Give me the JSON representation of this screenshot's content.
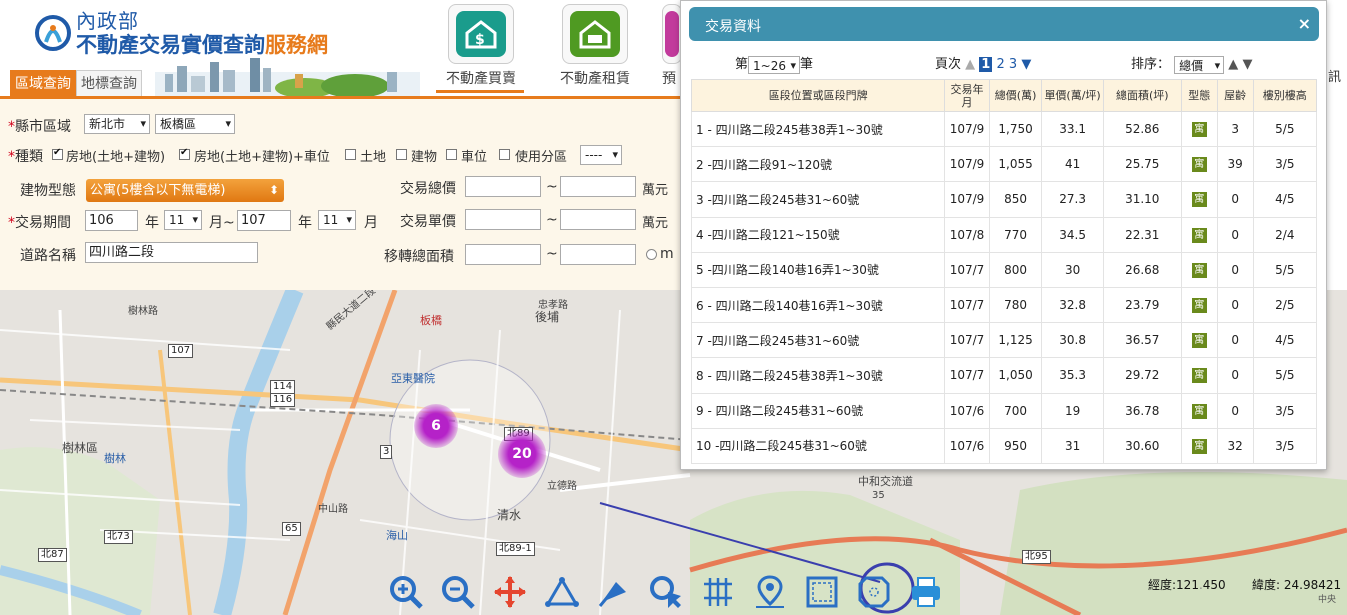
{
  "header": {
    "logo_line1": "內政部",
    "logo_line2_blue": "不動產交易實價查詢",
    "logo_line2_orange": "服務網",
    "tabs": [
      {
        "label": "區域查詢"
      },
      {
        "label": "地標查詢"
      }
    ],
    "nav": [
      {
        "label": "不動產買賣",
        "color": "#1a9c8c"
      },
      {
        "label": "不動產租賃",
        "color": "#4f9a22"
      },
      {
        "label": "預",
        "color": "#c23a9c"
      }
    ],
    "right_cut": "訊"
  },
  "form": {
    "district_label": "縣市區域",
    "city": "新北市",
    "district": "板橋區",
    "type_label": "種類",
    "types": [
      {
        "label": "房地(土地+建物)",
        "checked": true
      },
      {
        "label": "房地(土地+建物)+車位",
        "checked": true
      },
      {
        "label": "土地",
        "checked": false
      },
      {
        "label": "建物",
        "checked": false
      },
      {
        "label": "車位",
        "checked": false
      },
      {
        "label": "使用分區",
        "checked": false
      }
    ],
    "zone_select": "----",
    "building_label": "建物型態",
    "building_value": "公寓(5樓含以下無電梯)",
    "total_price_label": "交易總價",
    "unit_price_label": "交易單價",
    "area_label": "移轉總面積",
    "unit_wan": "萬元",
    "tilde": "~",
    "unit_m2": "m",
    "period_label": "交易期間",
    "year_from": "106",
    "month_from": "11",
    "year_to": "107",
    "month_to": "11",
    "year_txt": "年",
    "month_to_txt": "月~",
    "month_txt": "月",
    "road_label": "道路名稱",
    "road_value": "四川路二段"
  },
  "map": {
    "labels": [
      "樹林區",
      "樹林",
      "亞東醫院",
      "板橋",
      "後埔",
      "清水",
      "海山",
      "中和交流道",
      "忠孝路",
      "立德路",
      "縣民大道二段",
      "樹林路",
      "中山路",
      "北89",
      "北89-1",
      "北87",
      "北73",
      "北95",
      "107",
      "114",
      "116",
      "3",
      "65",
      "35"
    ],
    "clusters": [
      {
        "count": "6",
        "color": "#b522c8"
      },
      {
        "count": "20",
        "color": "#b522c8"
      }
    ],
    "tools": [
      "zoom-in-icon",
      "zoom-out-icon",
      "pan-icon",
      "measure-distance-icon",
      "measure-area-icon",
      "select-icon",
      "grid-icon",
      "locate-icon",
      "rectangle-select-icon",
      "polygon-select-icon",
      "print-icon"
    ],
    "lon_label": "經度:121",
    "lon_rest": "450",
    "lat_label": "緯度: 24.98421",
    "lat_sub": "中央"
  },
  "popup": {
    "title": "交易資料",
    "close": "×",
    "range_prefix": "第",
    "range_value": "1~26",
    "range_suffix": "筆",
    "page_label": "頁次",
    "pages": [
      "1",
      "2",
      "3"
    ],
    "sort_label": "排序：",
    "sort_value": "總價",
    "columns": [
      "區段位置或區段門牌",
      "交易年月",
      "總價(萬)",
      "單價(萬/坪)",
      "總面積(坪)",
      "型態",
      "屋齡",
      "樓別樓高"
    ],
    "rows": [
      {
        "addr": "1 - 四川路二段245巷38弄1~30號",
        "date": "107/9",
        "total": "1,750",
        "unit": "33.1",
        "area": "52.86",
        "type": "寓",
        "age": "3",
        "floor": "5/5"
      },
      {
        "addr": "2 -四川路二段91~120號",
        "date": "107/9",
        "total": "1,055",
        "unit": "41",
        "area": "25.75",
        "type": "寓",
        "age": "39",
        "floor": "3/5"
      },
      {
        "addr": "3 -四川路二段245巷31~60號",
        "date": "107/9",
        "total": "850",
        "unit": "27.3",
        "area": "31.10",
        "type": "寓",
        "age": "0",
        "floor": "4/5"
      },
      {
        "addr": "4 -四川路二段121~150號",
        "date": "107/8",
        "total": "770",
        "unit": "34.5",
        "area": "22.31",
        "type": "寓",
        "age": "0",
        "floor": "2/4"
      },
      {
        "addr": "5 -四川路二段140巷16弄1~30號",
        "date": "107/7",
        "total": "800",
        "unit": "30",
        "area": "26.68",
        "type": "寓",
        "age": "0",
        "floor": "5/5"
      },
      {
        "addr": "6 - 四川路二段140巷16弄1~30號",
        "date": "107/7",
        "total": "780",
        "unit": "32.8",
        "area": "23.79",
        "type": "寓",
        "age": "0",
        "floor": "2/5"
      },
      {
        "addr": "7 -四川路二段245巷31~60號",
        "date": "107/7",
        "total": "1,125",
        "unit": "30.8",
        "area": "36.57",
        "type": "寓",
        "age": "0",
        "floor": "4/5"
      },
      {
        "addr": "8 - 四川路二段245巷38弄1~30號",
        "date": "107/7",
        "total": "1,050",
        "unit": "35.3",
        "area": "29.72",
        "type": "寓",
        "age": "0",
        "floor": "5/5"
      },
      {
        "addr": "9 - 四川路二段245巷31~60號",
        "date": "107/6",
        "total": "700",
        "unit": "19",
        "area": "36.78",
        "type": "寓",
        "age": "0",
        "floor": "3/5"
      },
      {
        "addr": "10 -四川路二段245巷31~60號",
        "date": "107/6",
        "total": "950",
        "unit": "31",
        "area": "30.60",
        "type": "寓",
        "age": "32",
        "floor": "3/5"
      }
    ]
  }
}
